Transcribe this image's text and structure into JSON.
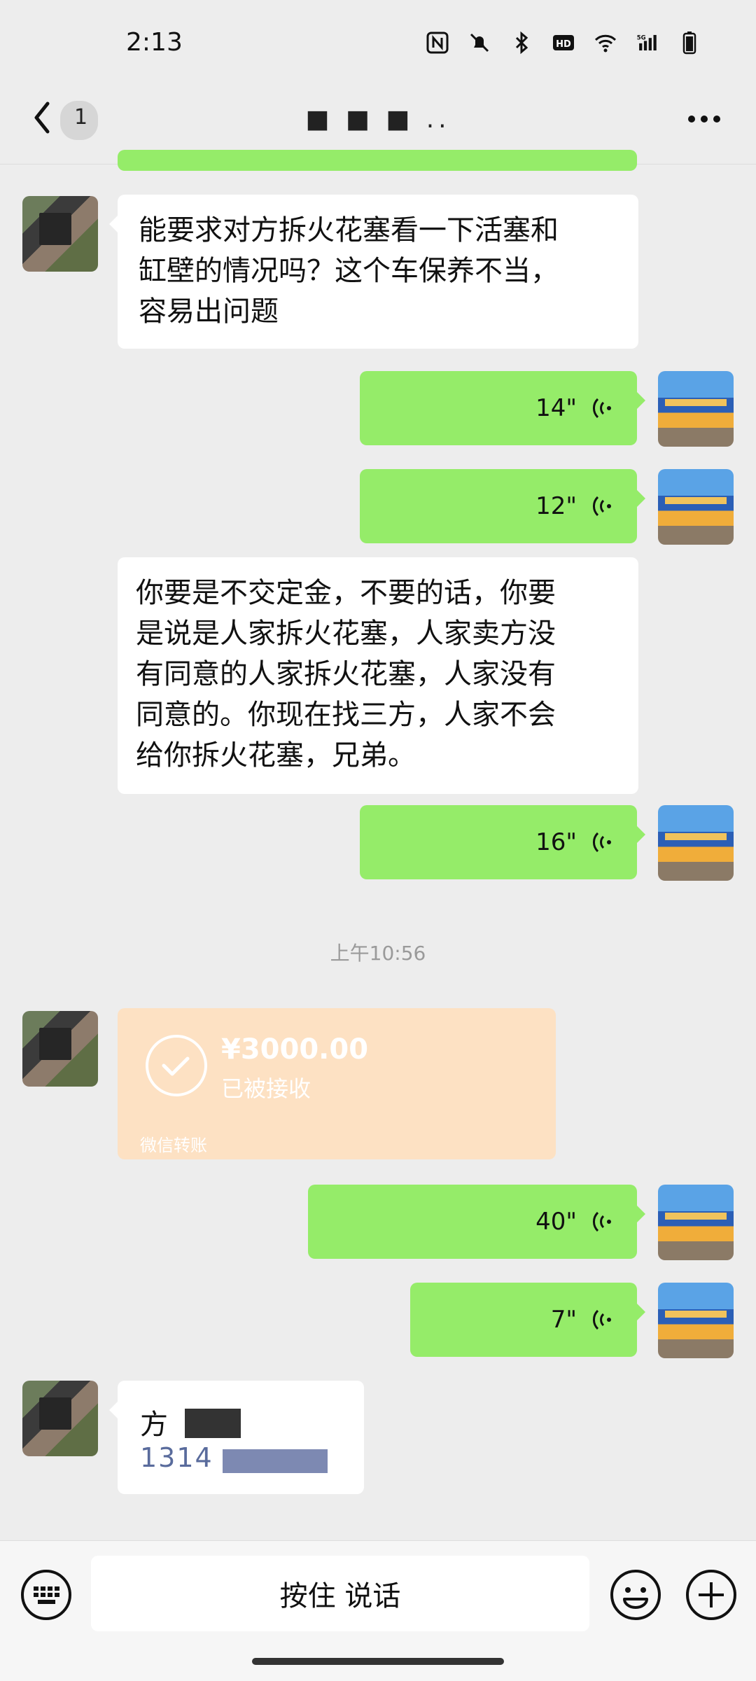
{
  "status_bar": {
    "time": "2:13",
    "icons": [
      "nfc-icon",
      "mute-bell-icon",
      "bluetooth-icon",
      "hd-icon",
      "wifi-icon",
      "5g-signal-icon",
      "battery-icon"
    ]
  },
  "nav": {
    "back_badge": "1",
    "title": "■ ■ ■ .."
  },
  "messages": [
    {
      "id": "m1",
      "side": "left",
      "type": "text",
      "text_lines": [
        "能要求对方拆火花塞看一下活塞和",
        "缸壁的情况吗？这个车保养不当，",
        "容易出问题"
      ]
    },
    {
      "id": "m2",
      "side": "right",
      "type": "voice",
      "duration": "14\""
    },
    {
      "id": "m3",
      "side": "right",
      "type": "voice",
      "duration": "12\""
    },
    {
      "id": "m4",
      "side": "left",
      "type": "text",
      "text_lines": [
        "你要是不交定金，不要的话，你要",
        "是说是人家拆火花塞，人家卖方没",
        "有同意的人家拆火花塞，人家没有",
        "同意的。你现在找三方，人家不会",
        "给你拆火花塞，兄弟。"
      ]
    },
    {
      "id": "m5",
      "side": "right",
      "type": "voice",
      "duration": "16\""
    },
    {
      "id": "t1",
      "type": "timestamp",
      "text": "上午10:56"
    },
    {
      "id": "m6",
      "side": "left",
      "type": "transfer",
      "amount": "¥3000.00",
      "status": "已被接收",
      "source": "微信转账"
    },
    {
      "id": "m7",
      "side": "right",
      "type": "voice",
      "duration": "40\""
    },
    {
      "id": "m8",
      "side": "right",
      "type": "voice",
      "duration": "7\""
    },
    {
      "id": "m9",
      "side": "left",
      "type": "contact",
      "name": "方",
      "phone": "1314"
    }
  ],
  "input_bar": {
    "hold_to_talk": "按住 说话"
  },
  "colors": {
    "background": "#ededed",
    "bubble_green": "#95ec69",
    "bubble_white": "#ffffff",
    "transfer_bg": "#fde1c3",
    "link_blue": "#596b9c"
  }
}
